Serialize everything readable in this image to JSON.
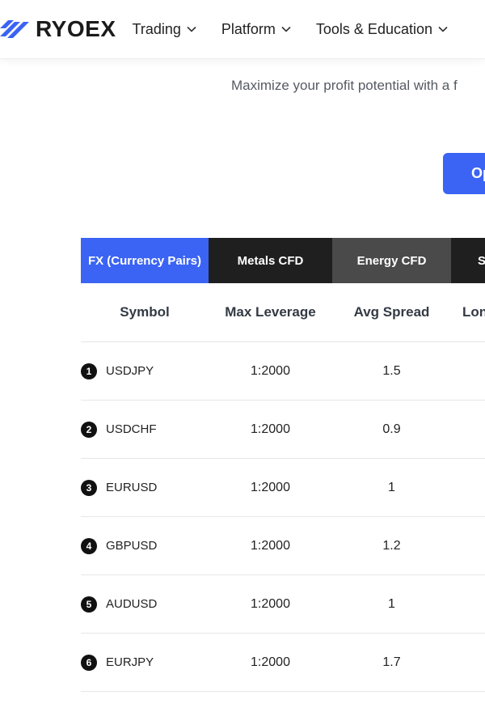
{
  "header": {
    "logo_text": "RYOEX",
    "nav": [
      {
        "label": "Trading"
      },
      {
        "label": "Platform"
      },
      {
        "label": "Tools & Education"
      }
    ]
  },
  "hero": {
    "subtitle": "Maximize your profit potential with a f",
    "open_button_label": "Op"
  },
  "tabs": [
    {
      "label": "FX (Currency Pairs)",
      "active": true
    },
    {
      "label": "Metals CFD",
      "active": false
    },
    {
      "label": "Energy CFD",
      "active": false
    },
    {
      "label": "S",
      "active": false
    }
  ],
  "table": {
    "headers": [
      "Symbol",
      "Max Leverage",
      "Avg Spread",
      "Lon"
    ],
    "rows": [
      {
        "rank": "1",
        "symbol": "USDJPY",
        "leverage": "1:2000",
        "spread": "1.5"
      },
      {
        "rank": "2",
        "symbol": "USDCHF",
        "leverage": "1:2000",
        "spread": "0.9"
      },
      {
        "rank": "3",
        "symbol": "EURUSD",
        "leverage": "1:2000",
        "spread": "1"
      },
      {
        "rank": "4",
        "symbol": "GBPUSD",
        "leverage": "1:2000",
        "spread": "1.2"
      },
      {
        "rank": "5",
        "symbol": "AUDUSD",
        "leverage": "1:2000",
        "spread": "1"
      },
      {
        "rank": "6",
        "symbol": "EURJPY",
        "leverage": "1:2000",
        "spread": "1.7"
      }
    ]
  },
  "colors": {
    "accent_blue": "#3b63f4",
    "tab_dark": "#1f1f1f",
    "tab_gray": "#4a4a4a",
    "logo_blue": "#3b63f4"
  }
}
